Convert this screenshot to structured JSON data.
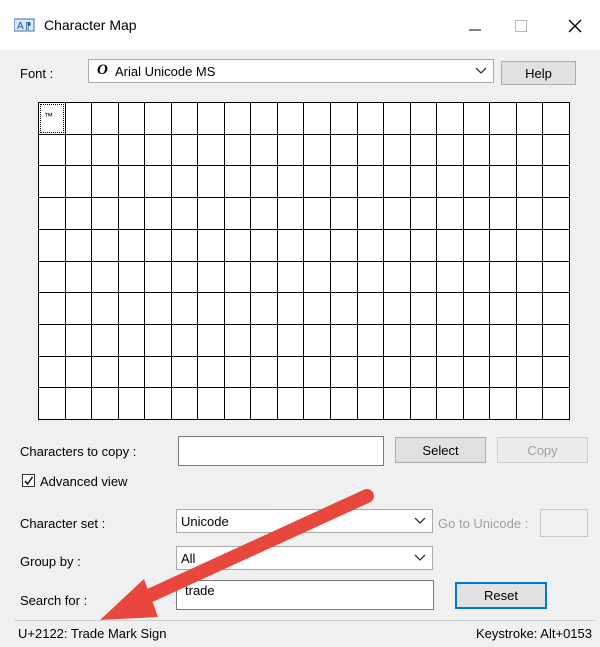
{
  "window": {
    "title": "Character Map",
    "icons": {
      "app": "character-map-icon",
      "minimize": "minimize-icon",
      "maximize": "maximize-icon",
      "close": "close-icon"
    }
  },
  "font_row": {
    "label": "Font :",
    "font_glyph": "O",
    "selected_font": "Arial Unicode MS",
    "help_label": "Help"
  },
  "grid": {
    "columns": 20,
    "rows": 10,
    "cells": [
      "™"
    ]
  },
  "copy_row": {
    "label": "Characters to copy :",
    "value": "",
    "select_label": "Select",
    "copy_label": "Copy"
  },
  "advanced_view": {
    "label": "Advanced view",
    "checked": true
  },
  "character_set": {
    "label": "Character set :",
    "value": "Unicode",
    "goto_label": "Go to Unicode :",
    "goto_value": ""
  },
  "group_by": {
    "label": "Group by :",
    "value": "All"
  },
  "search": {
    "label": "Search for :",
    "value": "trade",
    "reset_label": "Reset"
  },
  "status": {
    "char_info": "U+2122: Trade Mark Sign",
    "keystroke": "Keystroke: Alt+0153"
  },
  "annotation": {
    "arrow_color": "#e8473e"
  }
}
